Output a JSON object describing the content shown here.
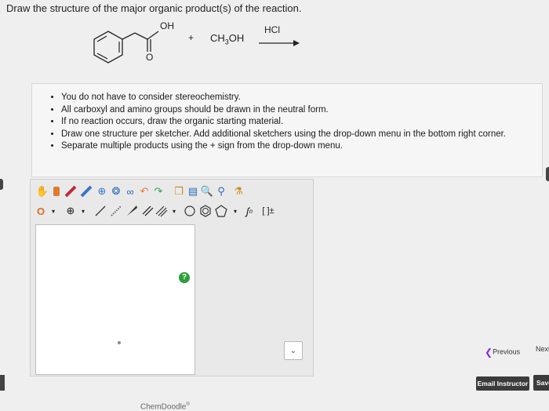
{
  "question": {
    "text": "Draw the structure of the major organic product(s) of the reaction."
  },
  "reaction": {
    "oh_label": "OH",
    "carbonyl_o_label": "O",
    "plus": "+",
    "reagent_prefix": "CH",
    "reagent_sub": "3",
    "reagent_suffix": "OH",
    "catalyst": "HCl"
  },
  "instructions": [
    "You do not have to consider stereochemistry.",
    "All carboxyl and amino groups should be drawn in the neutral form.",
    "If no reaction occurs, draw the organic starting material.",
    "Draw one structure per sketcher. Add additional sketchers using the drop-down menu in the bottom right corner.",
    "Separate multiple products using the + sign from the drop-down menu."
  ],
  "sketcher": {
    "brand": "ChemDoodle",
    "brand_mark": "®",
    "help": "?",
    "atom_label": "O",
    "charge_plus": "⊕",
    "template_label": "[ ]±"
  },
  "nav": {
    "previous": "Previous",
    "next": "Next",
    "email": "Email Instructor",
    "save": "Save"
  },
  "colors": {
    "help_green": "#2e9d3a",
    "atom_orange": "#e06b1f",
    "dark_button": "#3b3b3b"
  }
}
